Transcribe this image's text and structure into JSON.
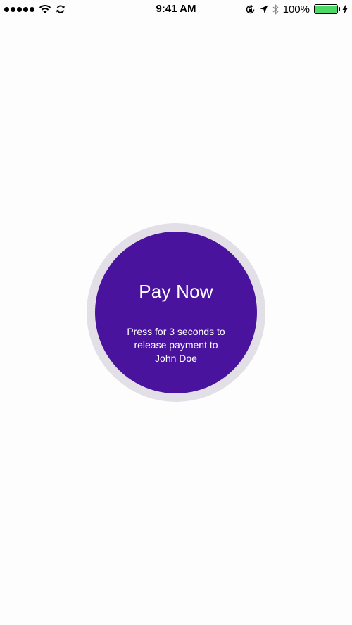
{
  "status_bar": {
    "time": "9:41 AM",
    "battery_percent": "100%",
    "battery_level": 1.0,
    "battery_color": "#4cd964",
    "signal_bars": 5,
    "icons": [
      "signal-dots-icon",
      "wifi-icon",
      "sync-icon",
      "orientation-lock-icon",
      "location-arrow-icon",
      "bluetooth-icon",
      "battery-icon",
      "charging-bolt-icon"
    ]
  },
  "pay_button": {
    "title": "Pay Now",
    "subtitle": "Press for 3 seconds to release payment to John Doe",
    "color": "#4a139e",
    "ring_color": "#e2e0e6"
  }
}
